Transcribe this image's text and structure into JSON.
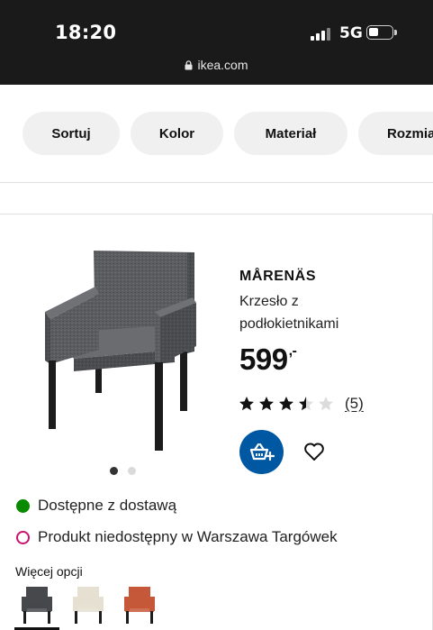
{
  "status_bar": {
    "time": "18:20",
    "network": "5G",
    "url": "ikea.com"
  },
  "filters": [
    {
      "label": "Sortuj"
    },
    {
      "label": "Kolor"
    },
    {
      "label": "Materiał"
    },
    {
      "label": "Rozmia"
    }
  ],
  "product": {
    "name": "MÅRENÄS",
    "description": "Krzesło z podłokietnikami",
    "price": "599",
    "price_suffix": ",-",
    "rating": 3.5,
    "rating_max": 5,
    "reviews": "(5)",
    "image_dots": {
      "count": 2,
      "active": 1
    },
    "icons": {
      "cart": "add-to-cart-icon",
      "favourite": "heart-icon"
    },
    "colors": {
      "accent": "#0058a3",
      "upholstery": "#55575b",
      "legs": "#1c1c1c"
    }
  },
  "availability": [
    {
      "text": "Dostępne z dostawą",
      "status": "available",
      "color": "#0a8a00"
    },
    {
      "text": "Produkt niedostępny w Warszawa Targówek",
      "status": "unavailable",
      "color": "#c8136d"
    }
  ],
  "more_options": {
    "label": "Więcej opcji",
    "variants": [
      {
        "color": "#46484c",
        "selected": true
      },
      {
        "color": "#e6e0d2",
        "selected": false
      },
      {
        "color": "#c55838",
        "selected": false
      }
    ]
  }
}
